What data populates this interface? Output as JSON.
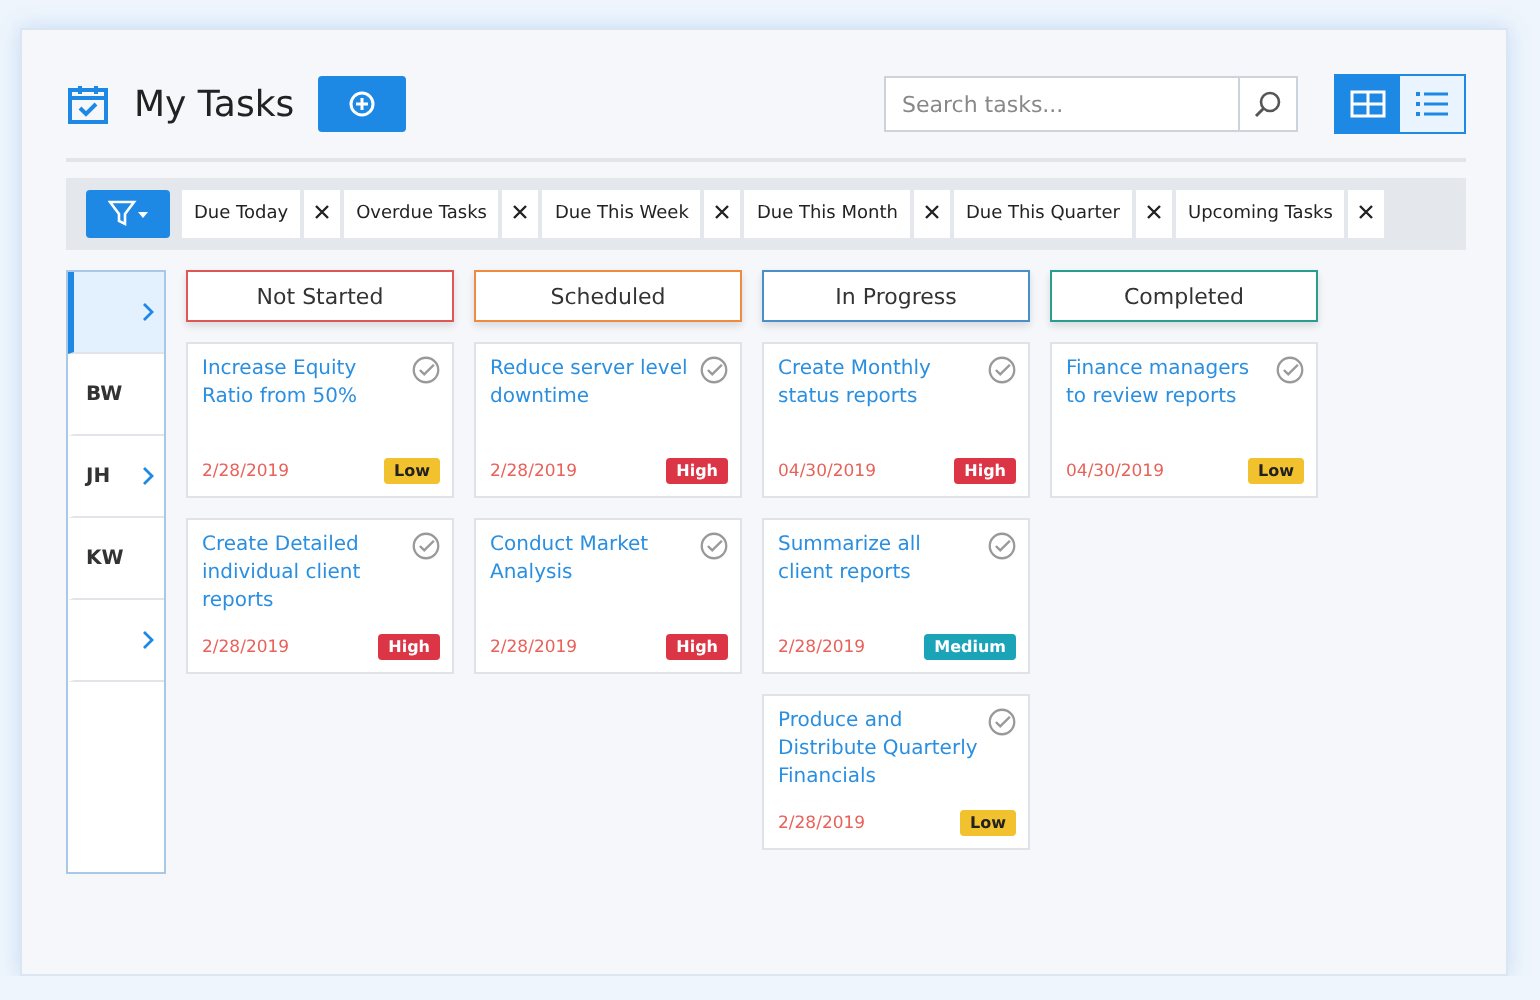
{
  "header": {
    "title": "My Tasks",
    "search": {
      "placeholder": "Search tasks..."
    },
    "views": [
      {
        "kind": "grid",
        "selected": true
      },
      {
        "kind": "list",
        "selected": false
      }
    ]
  },
  "filters": [
    {
      "label": "Due Today"
    },
    {
      "label": "Overdue Tasks"
    },
    {
      "label": "Due This Week"
    },
    {
      "label": "Due This Month"
    },
    {
      "label": "Due This Quarter"
    },
    {
      "label": "Upcoming Tasks"
    }
  ],
  "sidebar": {
    "items": [
      {
        "selected": true,
        "expandable": true
      },
      {
        "label": "BW",
        "selected": false,
        "expandable": false
      },
      {
        "label": "JH",
        "selected": false,
        "expandable": true
      },
      {
        "label": "KW",
        "selected": false,
        "expandable": false
      },
      {
        "selected": false,
        "expandable": true
      }
    ]
  },
  "columns": [
    {
      "title": "Not Started",
      "color": "#e05555",
      "cards": [
        {
          "title": "Increase Equity Ratio from 50%",
          "date": "2/28/2019",
          "priority": {
            "label": "Low",
            "color": "#f2c12e"
          }
        },
        {
          "title": "Create Detailed individual client reports",
          "date": "2/28/2019",
          "priority": {
            "label": "High",
            "color": "#dc3545"
          }
        }
      ]
    },
    {
      "title": "Scheduled",
      "color": "#f08a3c",
      "cards": [
        {
          "title": "Reduce server level downtime",
          "date": "2/28/2019",
          "priority": {
            "label": "High",
            "color": "#dc3545"
          }
        },
        {
          "title": "Conduct Market Analysis",
          "date": "2/28/2019",
          "priority": {
            "label": "High",
            "color": "#dc3545"
          }
        }
      ]
    },
    {
      "title": "In Progress",
      "color": "#4a90c8",
      "cards": [
        {
          "title": "Create Monthly status reports",
          "date": "04/30/2019",
          "priority": {
            "label": "High",
            "color": "#dc3545"
          }
        },
        {
          "title": "Summarize all client reports",
          "date": "2/28/2019",
          "priority": {
            "label": "Medium",
            "color": "#1ba3b8"
          }
        },
        {
          "title": "Produce and Distribute Quarterly Financials",
          "date": "2/28/2019",
          "priority": {
            "label": "Low",
            "color": "#f2c12e"
          }
        }
      ]
    },
    {
      "title": "Completed",
      "color": "#2a9d8f",
      "cards": [
        {
          "title": "Finance managers to review reports",
          "date": "04/30/2019",
          "priority": {
            "label": "Low",
            "color": "#f2c12e"
          }
        }
      ]
    }
  ]
}
